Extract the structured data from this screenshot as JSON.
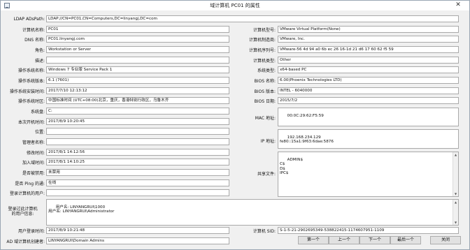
{
  "window": {
    "title": "域计算机 PC01 的属性",
    "close_glyph": "✕"
  },
  "ldap": {
    "label": "LDAP ADsPath:",
    "value": "LDAP://CN=PC01,CN=Computers,DC=linyangj,DC=com"
  },
  "left": {
    "name_label": "计算机名称:",
    "name_value": "PC01",
    "dns_label": "DNS 名称:",
    "dns_value": "PC01.linyangj.com",
    "role_label": "角色:",
    "role_value": "Workstation or Server",
    "desc_label": "描述:",
    "desc_value": "",
    "os_name_label": "操作系统名称:",
    "os_name_value": "Windows 7 专业版 Service Pack 1",
    "os_ver_label": "操作系统版本:",
    "os_ver_value": "6.1 (7601)",
    "os_install_label": "操作系统安装时间:",
    "os_install_value": "2017/7/10 12:13:12",
    "os_tz_label": "操作系统时区:",
    "os_tz_value": "中国标准时间 (UTC+08:00)北京，重庆，香港特别行政区，乌鲁木齐",
    "sys_disk_label": "系统盘:",
    "sys_disk_value": "C:",
    "boot_label": "本次开机时间:",
    "boot_value": "2017/8/9 10:20:45",
    "location_label": "位置:",
    "location_value": "",
    "manager_label": "管理者名称:",
    "manager_value": "",
    "modified_label": "修改时间:",
    "modified_value": "2017/8/1 14:12:56",
    "joined_label": "加入域时间:",
    "joined_value": "2017/8/1 14:10:25",
    "disabled_label": "是否被禁用:",
    "disabled_value": "未禁用",
    "ping_label": "是否 Ping 的通:",
    "ping_value": "在线",
    "logged_user_label": "登录计算机的用户:",
    "logged_user_value": ""
  },
  "right": {
    "model_label": "计算机型号:",
    "model_value": "VMware Virtual Platform(None)",
    "maker_label": "计算机制造商:",
    "maker_value": "VMware, Inc.",
    "serial_label": "计算机序列号:",
    "serial_value": "VMware-56 4d 94 a0 6b ec 26 16-1d 21 d6 17 60 62 f5 59",
    "type_label": "计算机类型:",
    "type_value": "Other",
    "arch_label": "系统类型:",
    "arch_value": "x64-based PC",
    "bios_name_label": "BIOS 名称:",
    "bios_name_value": "6.00(Phoenix Technologies LTD)",
    "bios_ver_label": "BIOS 版本:",
    "bios_ver_value": "INTEL - 6040000",
    "bios_date_label": "BIOS 日期:",
    "bios_date_value": "2015/7/2",
    "mac_label": "MAC 地址:",
    "mac_value": "00:0C:29:62:F5:59",
    "ip_label": "IP 地址:",
    "ip_value": "192.168.234.129\nfe80::15a1:9f63:6dae:5876",
    "share_label": "共享文件:",
    "share_value": "ADMIN$\nC$\nD$\nIPC$"
  },
  "history": {
    "label_line1": "登录过此计算机",
    "label_line2": "的用户信息:",
    "value": "用户名: LINYANGRUI\\1000\n用户名: LINYANGRUI\\Administrator"
  },
  "bottom": {
    "last_logon_label": "用户登录时间:",
    "last_logon_value": "2017/8/9 10:21:48",
    "creator_label": "AD 域计算机创建者:",
    "creator_value": "LINYANGRUI\\Domain Admins",
    "sid_label": "计算机 SID:",
    "sid_value": "S-1-5-21-2902695349-538822415-1174607951-1109"
  },
  "buttons": {
    "first": "第一个",
    "prev": "上一个",
    "next": "下一个",
    "last": "最后一个",
    "close": "关闭"
  }
}
